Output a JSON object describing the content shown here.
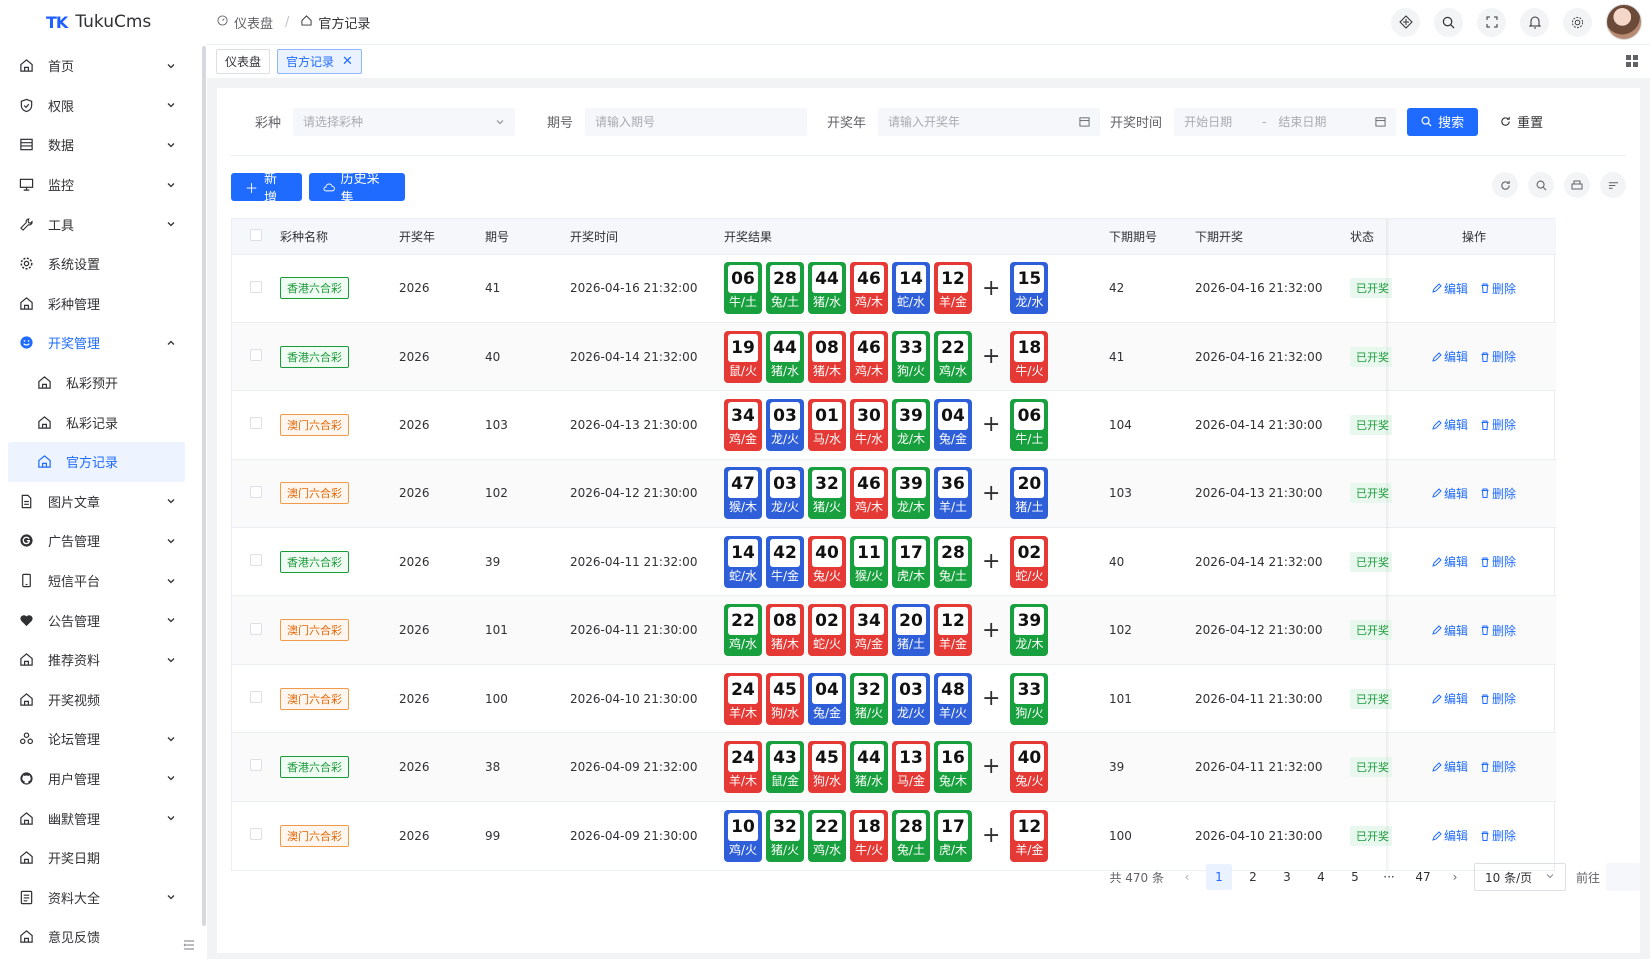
{
  "app": {
    "logo_mark_a": "TK",
    "title": "TukuCms"
  },
  "breadcrumb": [
    {
      "label": "仪表盘"
    },
    {
      "label": "官方记录"
    }
  ],
  "tabs": [
    {
      "label": "仪表盘"
    },
    {
      "label": "官方记录"
    }
  ],
  "sidebar": {
    "items": [
      {
        "label": "首页",
        "icon": "home-icon"
      },
      {
        "label": "权限",
        "icon": "shield-icon"
      },
      {
        "label": "数据",
        "icon": "table-icon"
      },
      {
        "label": "监控",
        "icon": "monitor-icon"
      },
      {
        "label": "工具",
        "icon": "wrench-icon"
      },
      {
        "label": "系统设置",
        "icon": "gear-icon"
      },
      {
        "label": "彩种管理",
        "icon": "home-icon"
      },
      {
        "label": "开奖管理",
        "icon": "smile-icon"
      },
      {
        "label": "私彩预开",
        "icon": "home-icon"
      },
      {
        "label": "私彩记录",
        "icon": "home-icon"
      },
      {
        "label": "官方记录",
        "icon": "home-icon"
      },
      {
        "label": "图片文章",
        "icon": "file-icon"
      },
      {
        "label": "广告管理",
        "icon": "g-icon"
      },
      {
        "label": "短信平台",
        "icon": "phone-icon"
      },
      {
        "label": "公告管理",
        "icon": "heart-icon"
      },
      {
        "label": "推荐资料",
        "icon": "home-icon"
      },
      {
        "label": "开奖视频",
        "icon": "home-icon"
      },
      {
        "label": "论坛管理",
        "icon": "community-icon"
      },
      {
        "label": "用户管理",
        "icon": "github-icon"
      },
      {
        "label": "幽默管理",
        "icon": "home-icon"
      },
      {
        "label": "开奖日期",
        "icon": "home-icon"
      },
      {
        "label": "资料大全",
        "icon": "doc-icon"
      },
      {
        "label": "意见反馈",
        "icon": "home-icon"
      }
    ]
  },
  "search": {
    "type_label": "彩种",
    "type_placeholder": "请选择彩种",
    "issue_label": "期号",
    "issue_placeholder": "请输入期号",
    "year_label": "开奖年",
    "year_placeholder": "请输入开奖年",
    "time_label": "开奖时间",
    "start_placeholder": "开始日期",
    "range_sep": "-",
    "end_placeholder": "结束日期",
    "search_btn": "搜索",
    "reset_btn": "重置"
  },
  "toolbar": {
    "add_btn": "新增",
    "history_btn": "历史采集"
  },
  "table": {
    "headers": [
      "彩种名称",
      "开奖年",
      "期号",
      "开奖时间",
      "开奖结果",
      "下期期号",
      "下期开奖",
      "状态",
      "操作"
    ],
    "edit_label": "编辑",
    "delete_label": "删除",
    "rows": [
      {
        "lottery": "香港六合彩",
        "kind": "hk",
        "year": "2026",
        "issue": "41",
        "time": "2026-04-16 21:32:00",
        "balls": [
          [
            "06",
            "牛/土",
            "green"
          ],
          [
            "28",
            "兔/土",
            "green"
          ],
          [
            "44",
            "猪/水",
            "green"
          ],
          [
            "46",
            "鸡/木",
            "red"
          ],
          [
            "14",
            "蛇/水",
            "blue"
          ],
          [
            "12",
            "羊/金",
            "red"
          ]
        ],
        "special": [
          "15",
          "龙/水",
          "blue"
        ],
        "next_issue": "42",
        "next_time": "2026-04-16 21:32:00",
        "status": "已开奖"
      },
      {
        "lottery": "香港六合彩",
        "kind": "hk",
        "year": "2026",
        "issue": "40",
        "time": "2026-04-14 21:32:00",
        "balls": [
          [
            "19",
            "鼠/火",
            "red"
          ],
          [
            "44",
            "猪/水",
            "green"
          ],
          [
            "08",
            "猪/木",
            "red"
          ],
          [
            "46",
            "鸡/木",
            "red"
          ],
          [
            "33",
            "狗/火",
            "green"
          ],
          [
            "22",
            "鸡/水",
            "green"
          ]
        ],
        "special": [
          "18",
          "牛/火",
          "red"
        ],
        "next_issue": "41",
        "next_time": "2026-04-16 21:32:00",
        "status": "已开奖"
      },
      {
        "lottery": "澳门六合彩",
        "kind": "mo",
        "year": "2026",
        "issue": "103",
        "time": "2026-04-13 21:30:00",
        "balls": [
          [
            "34",
            "鸡/金",
            "red"
          ],
          [
            "03",
            "龙/火",
            "blue"
          ],
          [
            "01",
            "马/水",
            "red"
          ],
          [
            "30",
            "牛/水",
            "red"
          ],
          [
            "39",
            "龙/木",
            "green"
          ],
          [
            "04",
            "兔/金",
            "blue"
          ]
        ],
        "special": [
          "06",
          "牛/土",
          "green"
        ],
        "next_issue": "104",
        "next_time": "2026-04-14 21:30:00",
        "status": "已开奖"
      },
      {
        "lottery": "澳门六合彩",
        "kind": "mo",
        "year": "2026",
        "issue": "102",
        "time": "2026-04-12 21:30:00",
        "balls": [
          [
            "47",
            "猴/木",
            "blue"
          ],
          [
            "03",
            "龙/火",
            "blue"
          ],
          [
            "32",
            "猪/火",
            "green"
          ],
          [
            "46",
            "鸡/木",
            "red"
          ],
          [
            "39",
            "龙/木",
            "green"
          ],
          [
            "36",
            "羊/土",
            "blue"
          ]
        ],
        "special": [
          "20",
          "猪/土",
          "blue"
        ],
        "next_issue": "103",
        "next_time": "2026-04-13 21:30:00",
        "status": "已开奖"
      },
      {
        "lottery": "香港六合彩",
        "kind": "hk",
        "year": "2026",
        "issue": "39",
        "time": "2026-04-11 21:32:00",
        "balls": [
          [
            "14",
            "蛇/水",
            "blue"
          ],
          [
            "42",
            "牛/金",
            "blue"
          ],
          [
            "40",
            "兔/火",
            "red"
          ],
          [
            "11",
            "猴/火",
            "green"
          ],
          [
            "17",
            "虎/木",
            "green"
          ],
          [
            "28",
            "兔/土",
            "green"
          ]
        ],
        "special": [
          "02",
          "蛇/火",
          "red"
        ],
        "next_issue": "40",
        "next_time": "2026-04-14 21:32:00",
        "status": "已开奖"
      },
      {
        "lottery": "澳门六合彩",
        "kind": "mo",
        "year": "2026",
        "issue": "101",
        "time": "2026-04-11 21:30:00",
        "balls": [
          [
            "22",
            "鸡/水",
            "green"
          ],
          [
            "08",
            "猪/木",
            "red"
          ],
          [
            "02",
            "蛇/火",
            "red"
          ],
          [
            "34",
            "鸡/金",
            "red"
          ],
          [
            "20",
            "猪/土",
            "blue"
          ],
          [
            "12",
            "羊/金",
            "red"
          ]
        ],
        "special": [
          "39",
          "龙/木",
          "green"
        ],
        "next_issue": "102",
        "next_time": "2026-04-12 21:30:00",
        "status": "已开奖"
      },
      {
        "lottery": "澳门六合彩",
        "kind": "mo",
        "year": "2026",
        "issue": "100",
        "time": "2026-04-10 21:30:00",
        "balls": [
          [
            "24",
            "羊/木",
            "red"
          ],
          [
            "45",
            "狗/水",
            "red"
          ],
          [
            "04",
            "兔/金",
            "blue"
          ],
          [
            "32",
            "猪/火",
            "green"
          ],
          [
            "03",
            "龙/火",
            "blue"
          ],
          [
            "48",
            "羊/火",
            "blue"
          ]
        ],
        "special": [
          "33",
          "狗/火",
          "green"
        ],
        "next_issue": "101",
        "next_time": "2026-04-11 21:30:00",
        "status": "已开奖"
      },
      {
        "lottery": "香港六合彩",
        "kind": "hk",
        "year": "2026",
        "issue": "38",
        "time": "2026-04-09 21:32:00",
        "balls": [
          [
            "24",
            "羊/木",
            "red"
          ],
          [
            "43",
            "鼠/金",
            "green"
          ],
          [
            "45",
            "狗/水",
            "red"
          ],
          [
            "44",
            "猪/水",
            "green"
          ],
          [
            "13",
            "马/金",
            "red"
          ],
          [
            "16",
            "兔/木",
            "green"
          ]
        ],
        "special": [
          "40",
          "兔/火",
          "red"
        ],
        "next_issue": "39",
        "next_time": "2026-04-11 21:32:00",
        "status": "已开奖"
      },
      {
        "lottery": "澳门六合彩",
        "kind": "mo",
        "year": "2026",
        "issue": "99",
        "time": "2026-04-09 21:30:00",
        "balls": [
          [
            "10",
            "鸡/火",
            "blue"
          ],
          [
            "32",
            "猪/火",
            "green"
          ],
          [
            "22",
            "鸡/水",
            "green"
          ],
          [
            "18",
            "牛/火",
            "red"
          ],
          [
            "28",
            "兔/土",
            "green"
          ],
          [
            "17",
            "虎/木",
            "green"
          ]
        ],
        "special": [
          "12",
          "羊/金",
          "red"
        ],
        "next_issue": "100",
        "next_time": "2026-04-10 21:30:00",
        "status": "已开奖"
      }
    ]
  },
  "pagination": {
    "total": "共 470 条",
    "pages": [
      "1",
      "2",
      "3",
      "4",
      "5",
      "···",
      "47"
    ],
    "current": "1",
    "size": "10 条/页",
    "goto": "前往"
  },
  "colors": {
    "primary": "#1f6bff",
    "red": "#e53935",
    "green": "#18a03e",
    "blue": "#2f5fd8"
  }
}
